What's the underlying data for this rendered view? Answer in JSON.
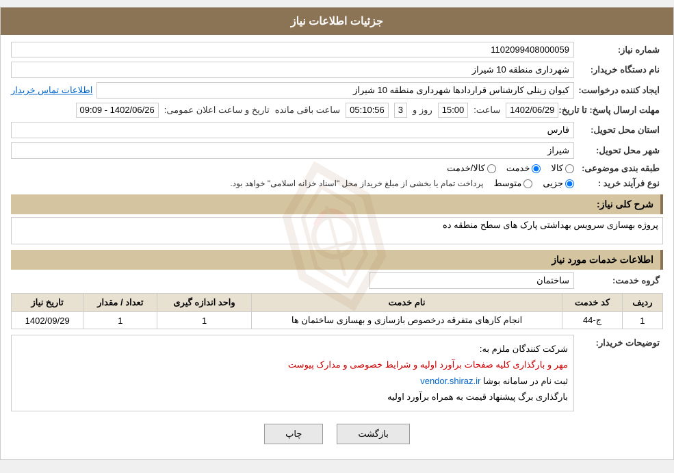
{
  "header": {
    "title": "جزئیات اطلاعات نیاز"
  },
  "fields": {
    "shomara_niaz_label": "شماره نیاز:",
    "shomara_niaz_value": "1102099408000059",
    "dasgah_label": "نام دستگاه خریدار:",
    "dasgah_value": "شهرداری منطقه 10 شیراز",
    "ijad_label": "ایجاد کننده درخواست:",
    "ijad_value": "کیوان زینلی کارشناس قراردادها شهرداری منطقه 10 شیراز",
    "ittilaat_link": "اطلاعات تماس خریدار",
    "mohlat_label": "مهلت ارسال پاسخ: تا تاریخ:",
    "date_value": "1402/06/29",
    "time_label": "ساعت:",
    "time_value": "15:00",
    "days_label": "روز و",
    "days_value": "3",
    "remaining_label": "ساعت باقی مانده",
    "remaining_value": "05:10:56",
    "announce_label": "تاریخ و ساعت اعلان عمومی:",
    "announce_value": "1402/06/26 - 09:09",
    "ostan_label": "استان محل تحویل:",
    "ostan_value": "فارس",
    "shahr_label": "شهر محل تحویل:",
    "shahr_value": "شیراز",
    "tabaqe_label": "طبقه بندی موضوعی:",
    "radio_kala": "کالا",
    "radio_khadamat": "خدمت",
    "radio_kala_khadamat": "کالا/خدمت",
    "selected_radio": "khadamat",
    "noeFarayand_label": "نوع فرآیند خرید :",
    "radio_jozvi": "جزیی",
    "radio_mottavasset": "متوسط",
    "noeFarayand_note": "پرداخت تمام یا بخشی از مبلغ خریداز محل \"اسناد خزانه اسلامی\" خواهد بود.",
    "sharh_label": "شرح کلی نیاز:",
    "sharh_value": "پروژه بهسازی سرویس بهداشتی  پارک های سطح منطقه ده",
    "khadamat_label": "اطلاعات خدمات مورد نیاز",
    "grohe_label": "گروه خدمت:",
    "grohe_value": "ساختمان",
    "table_headers": {
      "radif": "ردیف",
      "kod": "کد خدمت",
      "name": "نام خدمت",
      "vahed": "واحد اندازه گیری",
      "tedad": "تعداد / مقدار",
      "tarikh": "تاریخ نیاز"
    },
    "table_rows": [
      {
        "radif": "1",
        "kod": "ج-44",
        "name": "انجام کارهای متفرقه درخصوص بازسازی و بهسازی ساختمان ها",
        "vahed": "1",
        "tedad": "1",
        "tarikh": "1402/09/29"
      }
    ],
    "tawzih_label": "توضیحات خریدار:",
    "tawzih_line1": "شرکت کنندگان ملزم به:",
    "tawzih_line2": "مهر و بارگذاری کلیه صفحات برآورد اولیه و شرایط خصوصی و مدارک پیوست",
    "tawzih_line3_prefix": "ثبت نام در سامانه بوشا ",
    "tawzih_line3_link": "vendor.shiraz.ir",
    "tawzih_line4": "بارگذاری برگ پیشنهاد قیمت به همراه برآورد اولیه",
    "btn_print": "چاپ",
    "btn_back": "بازگشت"
  }
}
